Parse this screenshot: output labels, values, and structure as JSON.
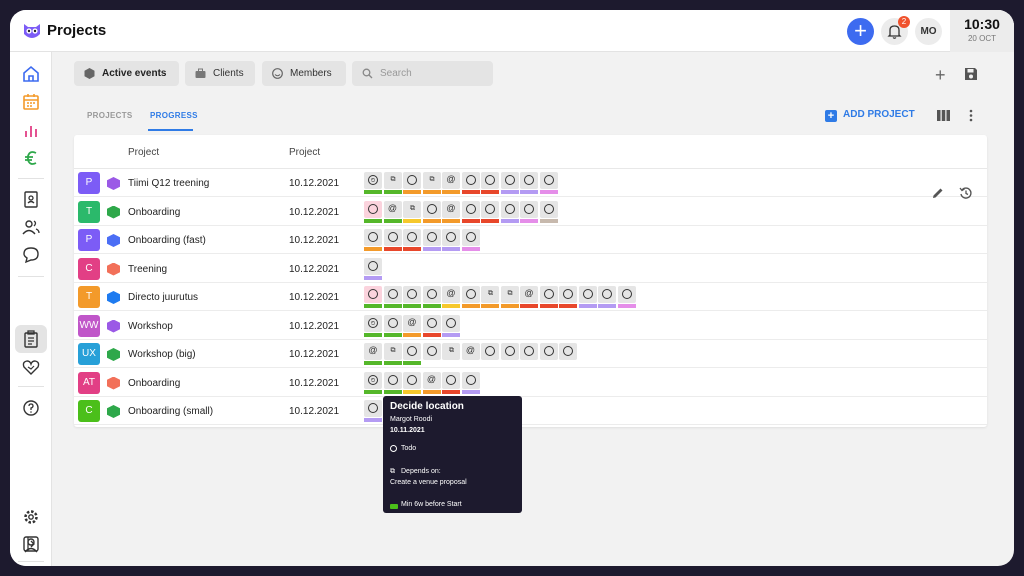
{
  "app": {
    "title": "Projects"
  },
  "header": {
    "notification_count": "2",
    "avatar": "MO",
    "time": "10:30",
    "date": "20 OCT"
  },
  "filters": {
    "active_events": "Active events",
    "clients": "Clients",
    "members": "Members",
    "search_placeholder": "Search"
  },
  "tabs": {
    "projects": "PROJECTS",
    "progress": "PROGRESS"
  },
  "actions": {
    "add_project": "ADD PROJECT"
  },
  "table": {
    "columns": [
      "Project",
      "Project"
    ],
    "rows": [
      {
        "abbr": "P",
        "abbr_color": "#7c5cf6",
        "hex_color": "#9b59e6",
        "name": "Tiimi Q12 treening",
        "date": "10.12.2021",
        "tasks": [
          [
            "clock",
            "#55b72a"
          ],
          [
            "dep",
            "#55b72a"
          ],
          [
            "circle",
            "#f39a2a"
          ],
          [
            "dep",
            "#f39a2a"
          ],
          [
            "at",
            "#f39a2a"
          ],
          [
            "circle",
            "#e8472b"
          ],
          [
            "circle",
            "#e8472b"
          ],
          [
            "circle",
            "#b49bf3"
          ],
          [
            "circle",
            "#b49bf3"
          ],
          [
            "circle",
            "#e58ee9"
          ]
        ]
      },
      {
        "abbr": "T",
        "abbr_color": "#2bb96b",
        "hex_color": "#2ea84a",
        "name": "Onboarding",
        "date": "10.12.2021",
        "tasks": [
          [
            "circle-pink",
            "#55b72a"
          ],
          [
            "at",
            "#55b72a"
          ],
          [
            "dep",
            "#f6c82c"
          ],
          [
            "circle",
            "#f39a2a"
          ],
          [
            "at",
            "#f39a2a"
          ],
          [
            "circle",
            "#e8472b"
          ],
          [
            "circle",
            "#e8472b"
          ],
          [
            "circle",
            "#b49bf3"
          ],
          [
            "circle",
            "#e58ee9"
          ],
          [
            "circle",
            "#c7b9ad"
          ]
        ]
      },
      {
        "abbr": "P",
        "abbr_color": "#7c5cf6",
        "hex_color": "#4b6ef5",
        "name": "Onboarding (fast)",
        "date": "10.12.2021",
        "tasks": [
          [
            "circle",
            "#f39a2a"
          ],
          [
            "circle",
            "#e8472b"
          ],
          [
            "circle",
            "#e8472b"
          ],
          [
            "circle",
            "#b49bf3"
          ],
          [
            "circle",
            "#b49bf3"
          ],
          [
            "circle",
            "#e58ee9"
          ]
        ]
      },
      {
        "abbr": "C",
        "abbr_color": "#e23f85",
        "hex_color": "#f27059",
        "name": "Treening",
        "date": "10.12.2021",
        "tasks": [
          [
            "circle",
            "#b49bf3"
          ]
        ]
      },
      {
        "abbr": "T",
        "abbr_color": "#f39a2a",
        "hex_color": "#1e7bf0",
        "name": "Directo juurutus",
        "date": "10.12.2021",
        "tasks": [
          [
            "circle-pink",
            "#55b72a"
          ],
          [
            "circle",
            "#55b72a"
          ],
          [
            "circle",
            "#55b72a"
          ],
          [
            "circle",
            "#55b72a"
          ],
          [
            "at",
            "#f6c82c"
          ],
          [
            "circle",
            "#f39a2a"
          ],
          [
            "dep",
            "#f39a2a"
          ],
          [
            "dep",
            "#f39a2a"
          ],
          [
            "at",
            "#e8472b"
          ],
          [
            "circle",
            "#e8472b"
          ],
          [
            "circle",
            "#e8472b"
          ],
          [
            "circle",
            "#b49bf3"
          ],
          [
            "circle",
            "#b49bf3"
          ],
          [
            "circle",
            "#e58ee9"
          ]
        ]
      },
      {
        "abbr": "WW",
        "abbr_color": "#c056c9",
        "hex_color": "#9b59e6",
        "name": "Workshop",
        "date": "10.12.2021",
        "tasks": [
          [
            "clock",
            "#55b72a"
          ],
          [
            "circle",
            "#55b72a"
          ],
          [
            "at",
            "#f39a2a"
          ],
          [
            "circle",
            "#e8472b"
          ],
          [
            "circle",
            "#b49bf3"
          ]
        ]
      },
      {
        "abbr": "UX",
        "abbr_color": "#27a0d8",
        "hex_color": "#2ea84a",
        "name": "Workshop (big)",
        "date": "10.12.2021",
        "tasks": [
          [
            "at",
            "#55b72a"
          ],
          [
            "dep",
            "#55b72a"
          ],
          [
            "circle",
            "#55b72a"
          ],
          [
            "circle",
            ""
          ],
          [
            "dep",
            ""
          ],
          [
            "at",
            ""
          ],
          [
            "circle",
            ""
          ],
          [
            "circle",
            ""
          ],
          [
            "circle",
            ""
          ],
          [
            "circle",
            ""
          ],
          [
            "circle",
            ""
          ]
        ]
      },
      {
        "abbr": "AT",
        "abbr_color": "#e23f85",
        "hex_color": "#f27059",
        "name": "Onboarding",
        "date": "10.12.2021",
        "tasks": [
          [
            "clock",
            "#55b72a"
          ],
          [
            "circle",
            "#55b72a"
          ],
          [
            "circle",
            "#f6c82c"
          ],
          [
            "at",
            "#f39a2a"
          ],
          [
            "circle",
            "#e8472b"
          ],
          [
            "circle",
            "#b49bf3"
          ]
        ]
      },
      {
        "abbr": "C",
        "abbr_color": "#4bbf1a",
        "hex_color": "#2ea84a",
        "name": "Onboarding (small)",
        "date": "10.12.2021",
        "tasks": [
          [
            "circle",
            "#b49bf3"
          ]
        ]
      }
    ]
  },
  "tooltip": {
    "title": "Decide location",
    "assignee": "Margot Roodi",
    "date": "10.11.2021",
    "status": "Todo",
    "depends_label": "Depends on:",
    "depends_task": "Create a venue proposal",
    "constraint": "Min 6w before Start"
  },
  "colors": {
    "accent": "#2f7be6",
    "primary_button": "#3d6bf0",
    "badge": "#f0522d"
  }
}
